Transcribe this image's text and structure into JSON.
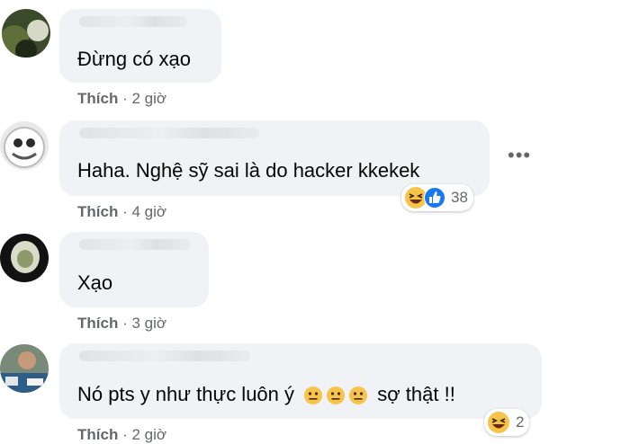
{
  "comments": [
    {
      "text": "Đừng có xạo",
      "like_label": "Thích",
      "separator": "·",
      "time": "2 giờ"
    },
    {
      "text": "Haha. Nghệ sỹ sai là do hacker kkekek",
      "like_label": "Thích",
      "separator": "·",
      "time": "4 giờ",
      "more_icon": "more-options-icon",
      "reactions": {
        "icons": [
          "haha-icon",
          "like-icon"
        ],
        "count": "38"
      }
    },
    {
      "text": "Xạo",
      "like_label": "Thích",
      "separator": "·",
      "time": "3 giờ"
    },
    {
      "text_before": "Nó pts y như thực luôn ý",
      "emojis": [
        "neutral-face-icon",
        "neutral-face-icon",
        "neutral-face-icon"
      ],
      "text_after": "sợ thật !!",
      "like_label": "Thích",
      "separator": "·",
      "time": "2 giờ",
      "reactions": {
        "icons": [
          "haha-icon"
        ],
        "count": "2"
      }
    }
  ],
  "colors": {
    "bubble": "#f0f2f5",
    "meta_text": "#65676b",
    "like_blue": "#1877f2",
    "haha_yellow": "#f7c34b"
  }
}
